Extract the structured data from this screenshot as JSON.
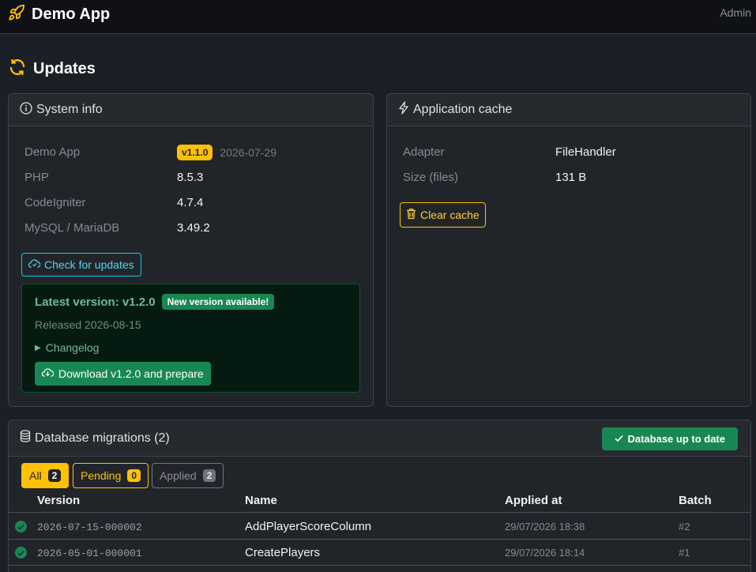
{
  "app": {
    "title": "Demo App",
    "user": "Admin"
  },
  "page": {
    "title": "Updates"
  },
  "system_info": {
    "title": "System info",
    "rows": [
      {
        "label": "Demo App",
        "value": "v1.1.0",
        "date": "2026-07-29"
      },
      {
        "label": "PHP",
        "value": "8.5.3"
      },
      {
        "label": "CodeIgniter",
        "value": "4.7.4"
      },
      {
        "label": "MySQL / MariaDB",
        "value": "3.49.2"
      }
    ],
    "check_button": "Check for updates",
    "latest": {
      "title": "Latest version: v1.2.0",
      "badge": "New version available!",
      "released": "Released 2026-08-15",
      "changelog": "Changelog",
      "download_button": "Download v1.2.0 and prepare"
    }
  },
  "cache": {
    "title": "Application cache",
    "rows": [
      {
        "label": "Adapter",
        "value": "FileHandler"
      },
      {
        "label": "Size (files)",
        "value": "131 B"
      }
    ],
    "clear_button": "Clear cache"
  },
  "migrations": {
    "title": "Database migrations (2)",
    "status_button": "Database up to date",
    "filters": [
      {
        "label": "All",
        "count": "2"
      },
      {
        "label": "Pending",
        "count": "0"
      },
      {
        "label": "Applied",
        "count": "2"
      }
    ],
    "columns": [
      "Version",
      "Name",
      "Applied at",
      "Batch"
    ],
    "rows": [
      {
        "version": "2026-07-15-000002",
        "name": "AddPlayerScoreColumn",
        "applied_at": "29/07/2026 18:38",
        "batch": "#2"
      },
      {
        "version": "2026-05-01-000001",
        "name": "CreatePlayers",
        "applied_at": "29/07/2026 18:14",
        "batch": "#1"
      }
    ]
  },
  "colors": {
    "accent": "#ffc107",
    "success": "#198754",
    "info": "#0dcaf0",
    "background": "#1b1f26"
  }
}
